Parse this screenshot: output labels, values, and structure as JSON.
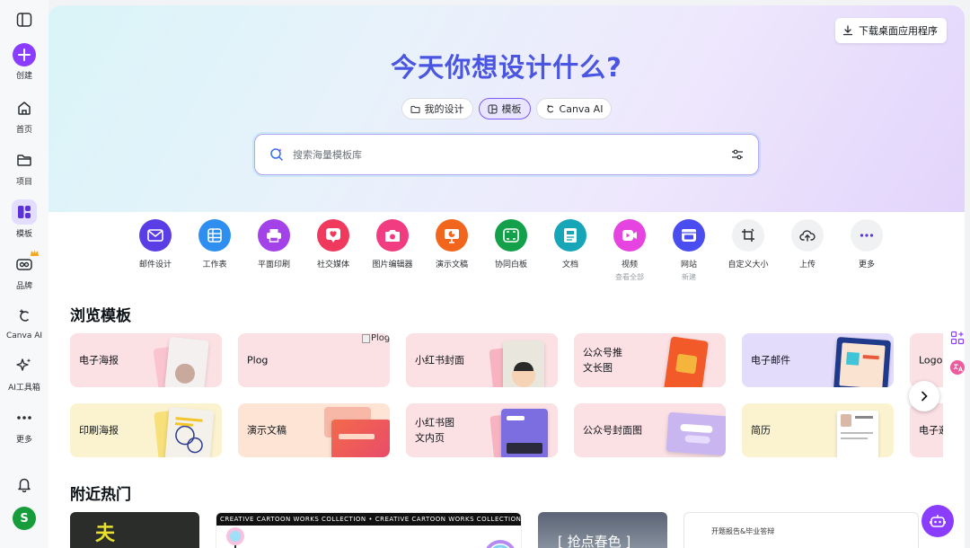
{
  "sidebar": {
    "items": [
      {
        "label": "创建"
      },
      {
        "label": "首页"
      },
      {
        "label": "项目"
      },
      {
        "label": "模板"
      },
      {
        "label": "品牌"
      },
      {
        "label": "Canva AI"
      },
      {
        "label": "AI工具箱"
      },
      {
        "label": "更多"
      }
    ],
    "avatar": "S"
  },
  "header": {
    "download_label": "下载桌面应用程序",
    "title": "今天你想设计什么?"
  },
  "tabs": [
    {
      "label": "我的设计"
    },
    {
      "label": "模板"
    },
    {
      "label": "Canva AI"
    }
  ],
  "search": {
    "placeholder": "搜索海量模板库"
  },
  "categories": [
    {
      "name": "邮件设计",
      "sub": "",
      "color": "#5b3de6"
    },
    {
      "name": "工作表",
      "sub": "",
      "color": "#2e8ff0"
    },
    {
      "name": "平面印刷",
      "sub": "",
      "color": "#a342e8"
    },
    {
      "name": "社交媒体",
      "sub": "",
      "color": "#ef3a5d"
    },
    {
      "name": "图片编辑器",
      "sub": "",
      "color": "#f23c82"
    },
    {
      "name": "演示文稿",
      "sub": "",
      "color": "#f2651c"
    },
    {
      "name": "协同白板",
      "sub": "",
      "color": "#13a04a"
    },
    {
      "name": "文档",
      "sub": "",
      "color": "#17a5b8"
    },
    {
      "name": "视频",
      "sub": "查看全部",
      "color": "#e544e0"
    },
    {
      "name": "网站",
      "sub": "新建",
      "color": "#4a4df0"
    },
    {
      "name": "自定义大小",
      "sub": "",
      "color": "#f0f1f3"
    },
    {
      "name": "上传",
      "sub": "",
      "color": "#f0f1f3"
    },
    {
      "name": "更多",
      "sub": "",
      "color": "#f0f1f3"
    }
  ],
  "browse": {
    "title": "浏览模板",
    "row1": [
      {
        "label": "电子海报",
        "bg": "#fbe0e4"
      },
      {
        "label": "Plog",
        "bg": "#fbe0e4",
        "alt": "Plog"
      },
      {
        "label": "小红书封面",
        "bg": "#fbe0e4"
      },
      {
        "label": "公众号推\n文长图",
        "bg": "#fbe0e4"
      },
      {
        "label": "电子邮件",
        "bg": "#e4dcfb"
      },
      {
        "label": "Logo",
        "bg": "#fbe0e4"
      }
    ],
    "row2": [
      {
        "label": "印刷海报",
        "bg": "#fbf3cf"
      },
      {
        "label": "演示文稿",
        "bg": "#fde4d5"
      },
      {
        "label": "小红书图\n文内页",
        "bg": "#fbe0e4"
      },
      {
        "label": "公众号封面图",
        "bg": "#fbe0e4"
      },
      {
        "label": "简历",
        "bg": "#fbf3cf"
      },
      {
        "label": "电子邀",
        "bg": "#fbe0e4"
      }
    ]
  },
  "nearby": {
    "title": "附近热门",
    "cards": [
      {
        "text": "夫"
      },
      {
        "text": "CREATIVE CARTOON WORKS COLLECTION  •  CREATIVE CARTOON WORKS COLLECTION"
      },
      {
        "text": "[ 抢点春色 ]"
      },
      {
        "text": "开题报告&毕业答辩"
      }
    ]
  }
}
